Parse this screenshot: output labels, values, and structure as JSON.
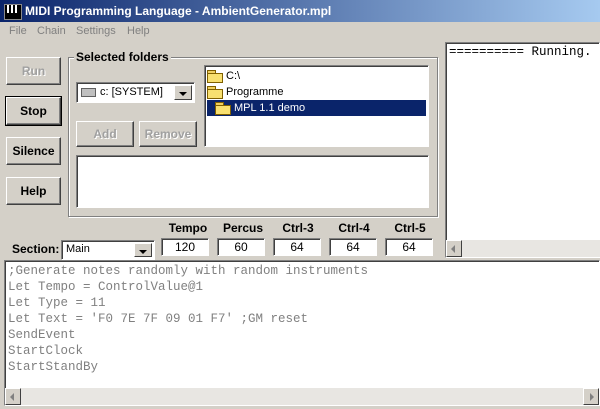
{
  "window": {
    "title": "MIDI Programming Language - AmbientGenerator.mpl"
  },
  "menu": {
    "items": [
      "File",
      "Chain",
      "Settings",
      "Help"
    ]
  },
  "buttons": {
    "run": "Run",
    "stop": "Stop",
    "silence": "Silence",
    "help": "Help",
    "add": "Add",
    "remove": "Remove"
  },
  "folders": {
    "group_label": "Selected folders",
    "drive": "c: [SYSTEM]",
    "tree": [
      "C:\\",
      "Programme",
      "MPL 1.1 demo"
    ]
  },
  "controls": [
    {
      "label": "Tempo",
      "value": "120"
    },
    {
      "label": "Percus",
      "value": "60"
    },
    {
      "label": "Ctrl-3",
      "value": "64"
    },
    {
      "label": "Ctrl-4",
      "value": "64"
    },
    {
      "label": "Ctrl-5",
      "value": "64"
    }
  ],
  "section": {
    "label": "Section:",
    "value": "Main"
  },
  "output": {
    "text": "========== Running."
  },
  "code": {
    "lines": [
      ";Generate notes randomly with random instruments",
      "Let Tempo = ControlValue@1",
      "Let Type = 11",
      "Let Text = 'F0 7E 7F 09 01 F7' ;GM reset",
      "SendEvent",
      "StartClock",
      "StartStandBy"
    ]
  },
  "colors": {
    "titlebar_start": "#0a246a",
    "titlebar_end": "#a6caf0",
    "selection": "#0a246a",
    "face": "#d4d0c8"
  }
}
